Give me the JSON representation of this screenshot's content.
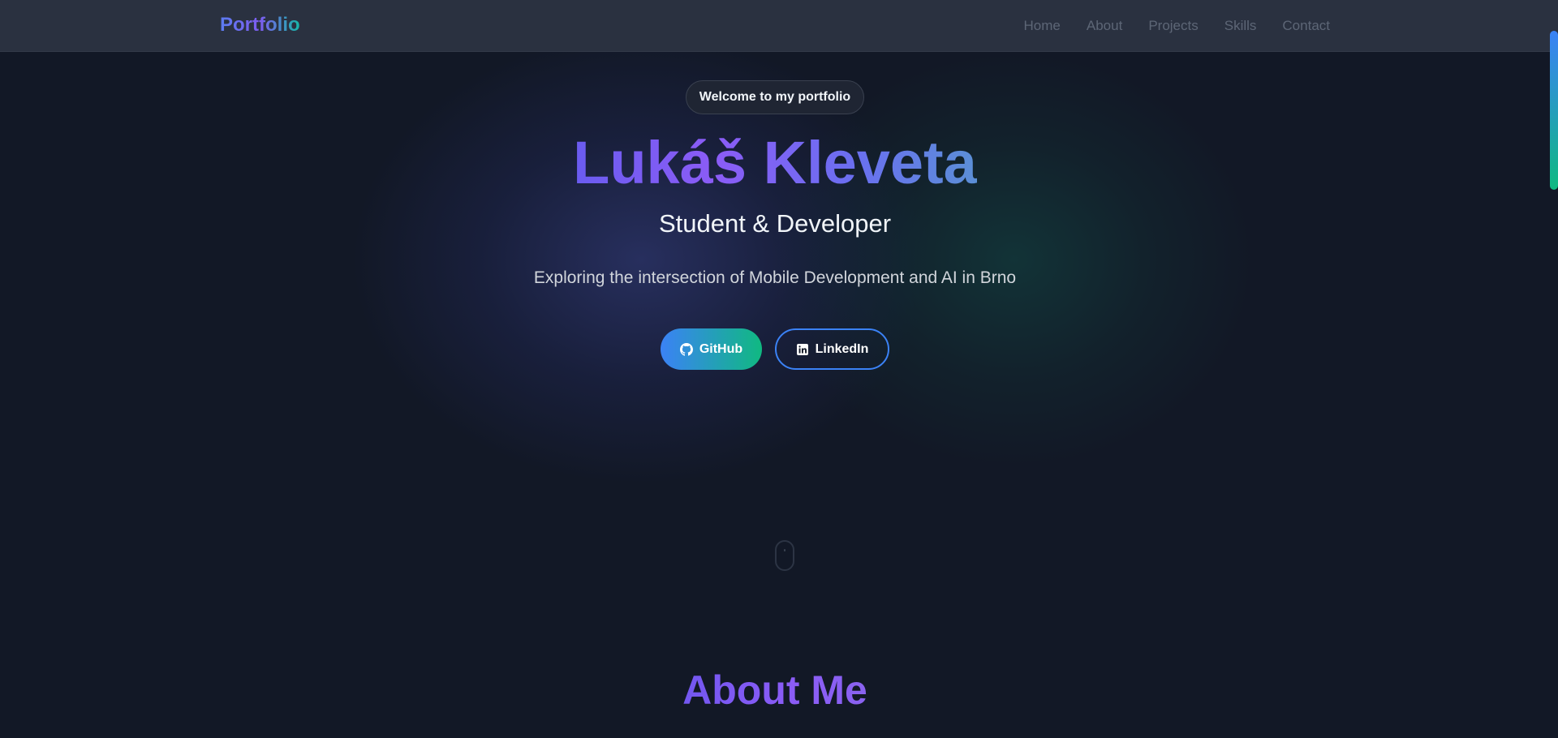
{
  "nav": {
    "brand": "Portfolio",
    "links": [
      "Home",
      "About",
      "Projects",
      "Skills",
      "Contact"
    ]
  },
  "hero": {
    "badge": "Welcome to my portfolio",
    "name": "Lukáš Kleveta",
    "role": "Student & Developer",
    "tagline": "Exploring the intersection of Mobile Development and AI in Brno",
    "buttons": {
      "github": "GitHub",
      "linkedin": "LinkedIn"
    },
    "scroll_indicator_icon": "mouse-icon"
  },
  "about": {
    "heading": "About Me"
  },
  "icons": {
    "github": "github-icon",
    "linkedin": "linkedin-icon"
  },
  "colors": {
    "background": "#121826",
    "navbar": "#2a3140",
    "accent_blue": "#3b82f6",
    "accent_green": "#10b981",
    "accent_purple": "#8b5cf6",
    "nav_link": "#5d6676"
  }
}
